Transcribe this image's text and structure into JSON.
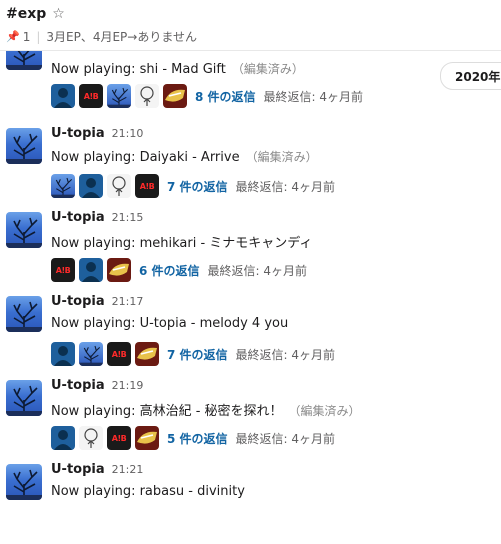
{
  "channel": {
    "name": "#exp",
    "pin_count": "1",
    "topic": "3月EP、4月EP→ありません"
  },
  "date_pill": "2020年",
  "messages": [
    {
      "author": "",
      "time": "",
      "text": "Now playing: shi - Mad Gift",
      "edited": "（編集済み）",
      "reply_avatars": [
        "person",
        "red",
        "tree",
        "ghost",
        "yellow"
      ],
      "thread_count": "8 件の返信",
      "last_reply": "最終返信: 4ヶ月前"
    },
    {
      "author": "U-topia",
      "time": "21:10",
      "text": "Now playing: Daiyaki - Arrive",
      "edited": "（編集済み）",
      "reply_avatars": [
        "tree",
        "person",
        "ghost",
        "red"
      ],
      "thread_count": "7 件の返信",
      "last_reply": "最終返信: 4ヶ月前"
    },
    {
      "author": "U-topia",
      "time": "21:15",
      "text": "Now playing: mehikari - ミナモキャンディ",
      "edited": "",
      "reply_avatars": [
        "red",
        "person",
        "yellow"
      ],
      "thread_count": "6 件の返信",
      "last_reply": "最終返信: 4ヶ月前"
    },
    {
      "author": "U-topia",
      "time": "21:17",
      "text": "Now playing: U-topia - melody 4 you",
      "edited": "",
      "reply_avatars": [
        "person",
        "tree",
        "red",
        "yellow"
      ],
      "thread_count": "7 件の返信",
      "last_reply": "最終返信: 4ヶ月前"
    },
    {
      "author": "U-topia",
      "time": "21:19",
      "text": "Now playing: 高林治紀 - 秘密を探れ！",
      "edited": "（編集済み）",
      "reply_avatars": [
        "person",
        "ghost",
        "red",
        "yellow"
      ],
      "thread_count": "5 件の返信",
      "last_reply": "最終返信: 4ヶ月前"
    },
    {
      "author": "U-topia",
      "time": "21:21",
      "text": "Now playing: rabasu - divinity",
      "edited": "",
      "reply_avatars": [],
      "thread_count": "",
      "last_reply": ""
    }
  ],
  "red_avatar_text": "A!B",
  "colors": {
    "link": "#1264a3",
    "muted": "#616061"
  }
}
